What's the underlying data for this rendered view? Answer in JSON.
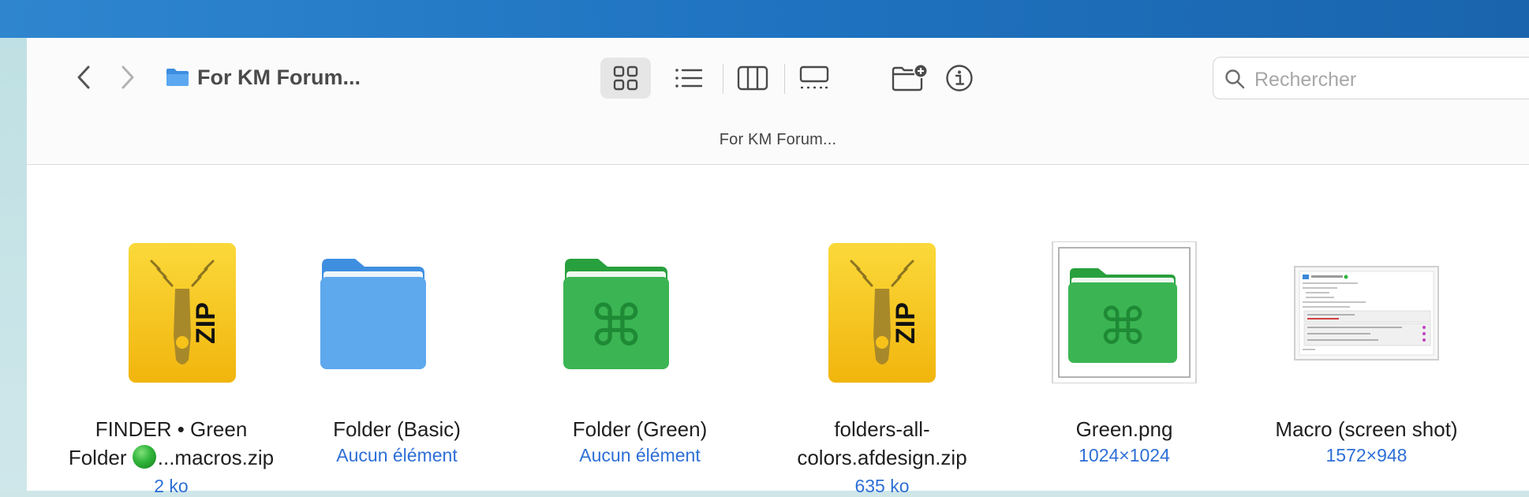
{
  "window": {
    "title": "For KM Forum...",
    "subtitle": "For KM Forum...",
    "folder_icon": "folder-icon"
  },
  "toolbar": {
    "back_icon": "chevron-left-icon",
    "forward_icon": "chevron-right-icon",
    "views": [
      {
        "icon": "icon-view-icon",
        "active": true
      },
      {
        "icon": "list-view-icon",
        "active": false
      },
      {
        "icon": "column-view-icon",
        "active": false
      },
      {
        "icon": "gallery-view-icon",
        "active": false
      }
    ],
    "new_folder_icon": "new-folder-icon",
    "info_icon": "info-icon"
  },
  "search": {
    "placeholder": "Rechercher",
    "icon": "search-icon"
  },
  "files": [
    {
      "name_line1": "FINDER • Green",
      "name_line2_before": "Folder ",
      "name_line2_after": "...macros.zip",
      "meta": "2 ko",
      "icon": "zip-archive-icon"
    },
    {
      "name_line1": "Folder (Basic)",
      "meta": "Aucun élément",
      "icon": "blue-folder-icon"
    },
    {
      "name_line1": "Folder (Green)",
      "meta": "Aucun élément",
      "icon": "green-command-folder-icon"
    },
    {
      "name_line1": "folders-all-",
      "name_line2": "colors.afdesign.zip",
      "meta": "635 ko",
      "icon": "zip-archive-icon"
    },
    {
      "name_line1": "Green.png",
      "meta": "1024×1024",
      "icon": "image-thumbnail-icon"
    },
    {
      "name_line1": "Macro (screen shot)",
      "meta": "1572×948",
      "icon": "screenshot-thumbnail-icon"
    }
  ],
  "colors": {
    "accent_text": "#2d6fd6",
    "folder_blue": "#5aa3ea",
    "folder_green": "#34b14a",
    "zip_yellow": "#f7c21a"
  }
}
